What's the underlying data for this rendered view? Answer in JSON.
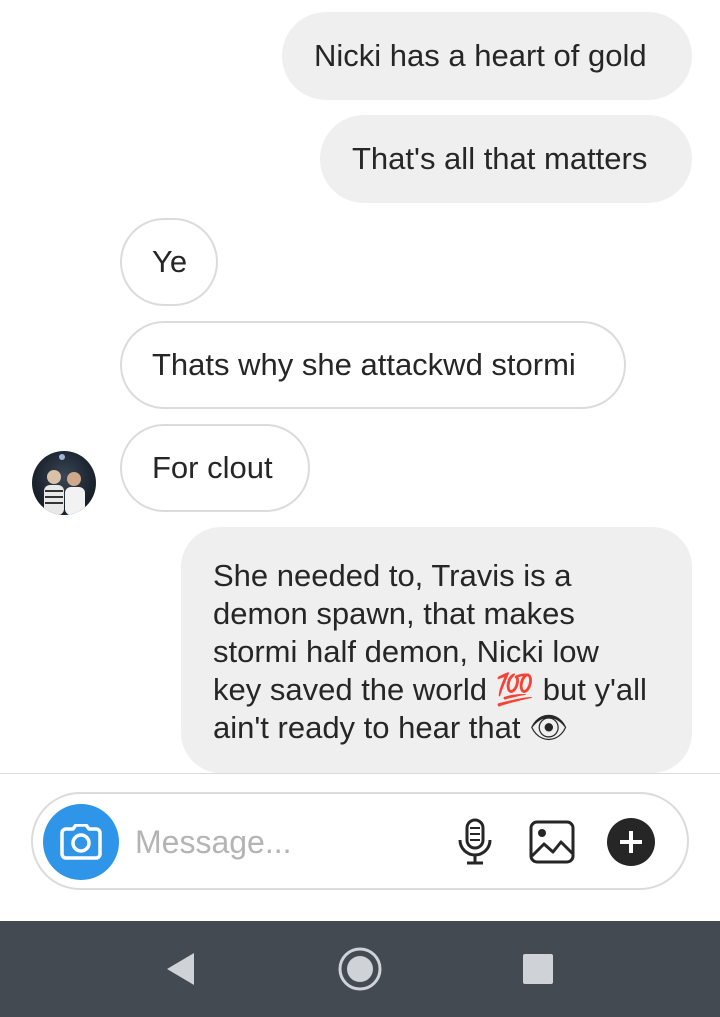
{
  "messages": [
    {
      "direction": "sent",
      "text": "Nicki has a heart of gold"
    },
    {
      "direction": "sent",
      "text": "That's all that matters"
    },
    {
      "direction": "received",
      "text": "Ye"
    },
    {
      "direction": "received",
      "text": "Thats why she attackwd stormi"
    },
    {
      "direction": "received",
      "text": "For clout"
    },
    {
      "direction": "sent",
      "lines": [
        "She needed to, Travis is a",
        "demon spawn, that makes",
        "stormi half demon, Nicki low",
        "key saved the world 💯 but y'all",
        "ain't ready to hear that 👁"
      ]
    }
  ],
  "composer": {
    "placeholder": "Message...",
    "icons": [
      "camera-icon",
      "microphone-icon",
      "gallery-icon",
      "plus-icon"
    ]
  },
  "navigation": {
    "icons": [
      "back-icon",
      "home-icon",
      "recents-icon"
    ]
  },
  "colors": {
    "sent_bubble": "#efefef",
    "received_border": "#dbdbdb",
    "camera_button": "#2f95e8",
    "nav_bar": "#434a52"
  }
}
